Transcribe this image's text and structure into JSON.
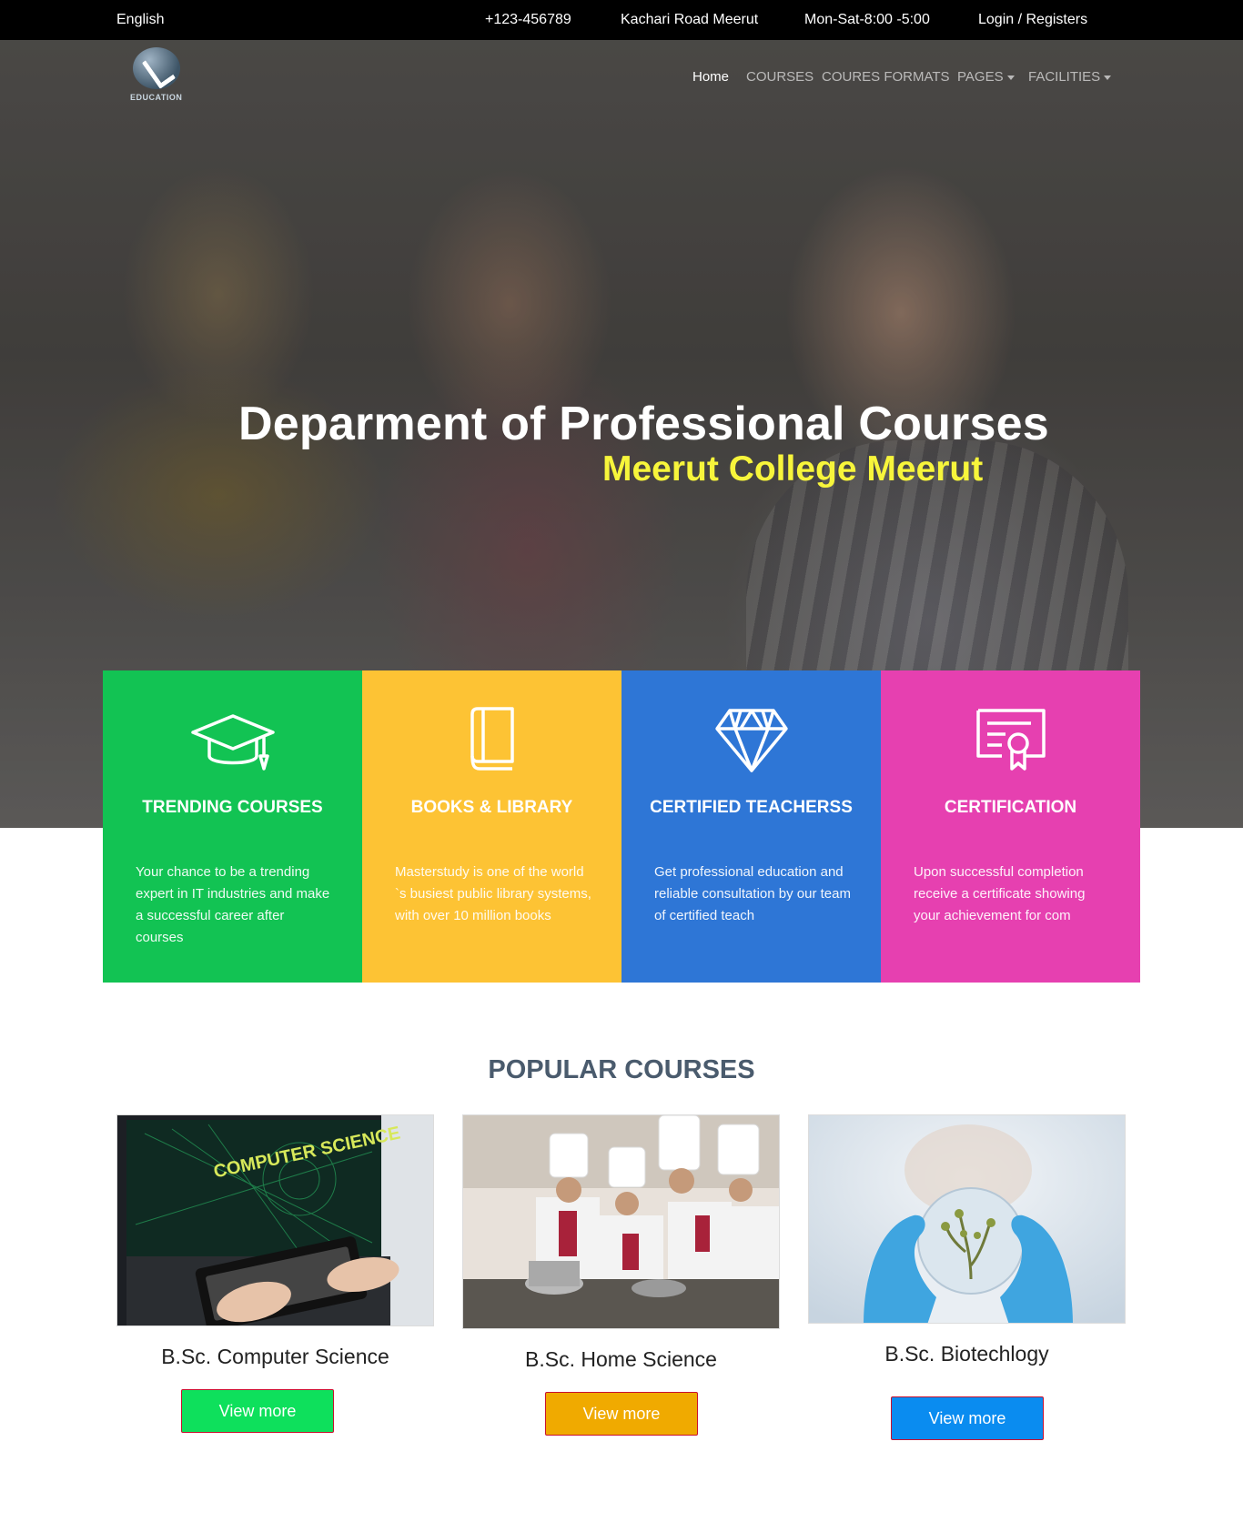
{
  "topbar": {
    "language": "English",
    "phone": "+123-456789",
    "address": "Kachari Road Meerut",
    "hours": "Mon-Sat-8:00 -5:00",
    "login": "Login / Registers"
  },
  "logo": {
    "text": "EDUCATION"
  },
  "nav": {
    "items": [
      {
        "label": "Home",
        "active": true
      },
      {
        "label": "COURSES",
        "active": false
      },
      {
        "label": "COURES FORMATS",
        "active": false
      },
      {
        "label": "PAGES",
        "active": false,
        "dropdown": true
      },
      {
        "label": "FACILITIES",
        "active": false,
        "dropdown": true
      }
    ]
  },
  "hero": {
    "title": "Deparment of Professional Courses",
    "subtitle": "Meerut College Meerut"
  },
  "features": [
    {
      "title": "TRENDING COURSES",
      "text": "Your chance to be a trending expert in IT industries and make a successful career after courses",
      "icon": "graduation-cap-icon",
      "color": "#12c353"
    },
    {
      "title": "BOOKS & LIBRARY",
      "text": "Masterstudy is one of the world `s busiest public library systems, with over 10 million books",
      "icon": "book-icon",
      "color": "#fdc334"
    },
    {
      "title": "CERTIFIED TEACHERSS",
      "text": "Get professional education and reliable consultation by our team of certified teach",
      "icon": "diamond-icon",
      "color": "#2e76d6"
    },
    {
      "title": "CERTIFICATION",
      "text": "Upon successful completion receive a certificate showing your achievement for com",
      "icon": "certificate-icon",
      "color": "#e640b0"
    }
  ],
  "popular": {
    "title": "POPULAR COURSES",
    "courses": [
      {
        "name": "B.Sc. Computer Science",
        "button": "View more",
        "button_color": "#0ee05c",
        "image_text": "COMPUTER SCIENCE"
      },
      {
        "name": "B.Sc. Home Science",
        "button": "View more",
        "button_color": "#f0aa00"
      },
      {
        "name": "B.Sc. Biotechlogy",
        "button": "View more",
        "button_color": "#0a8cf0"
      }
    ]
  }
}
